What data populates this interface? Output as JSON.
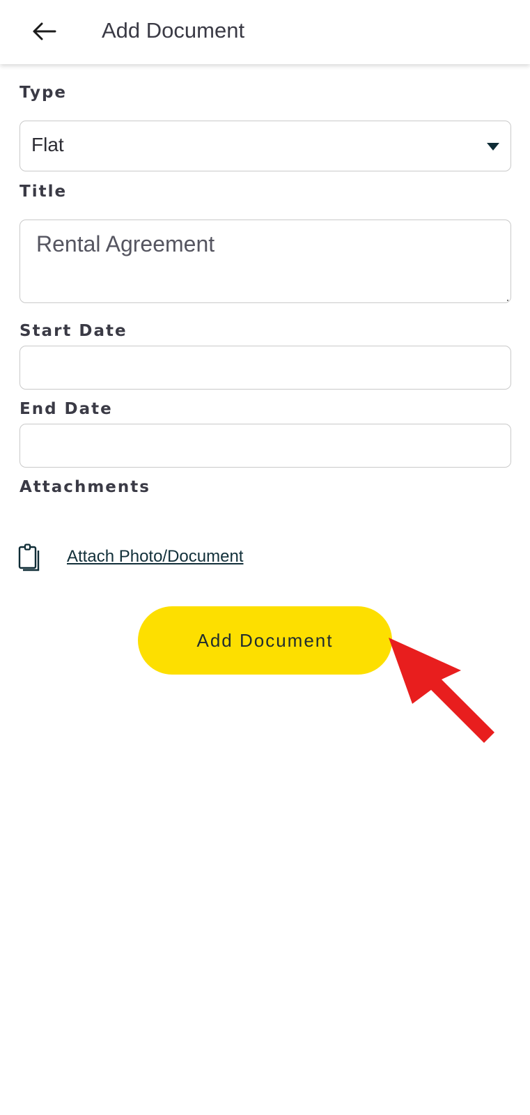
{
  "header": {
    "back_icon": "arrow-left-icon",
    "title": "Add Document"
  },
  "form": {
    "type": {
      "label": "Type",
      "selected": "Flat",
      "dropdown_icon": "caret-down-icon"
    },
    "title": {
      "label": "Title",
      "value": "Rental Agreement"
    },
    "start_date": {
      "label": "Start Date",
      "value": ""
    },
    "end_date": {
      "label": "End Date",
      "value": ""
    },
    "attachments": {
      "label": "Attachments",
      "icon": "clipboard-icon",
      "link_text": "Attach Photo/Document"
    },
    "submit_label": "Add Document"
  },
  "annotation": {
    "icon": "red-arrow-pointer",
    "color": "#e81e1e"
  },
  "colors": {
    "accent": "#fddf00",
    "text": "#3a3a45",
    "link": "#12303a"
  }
}
